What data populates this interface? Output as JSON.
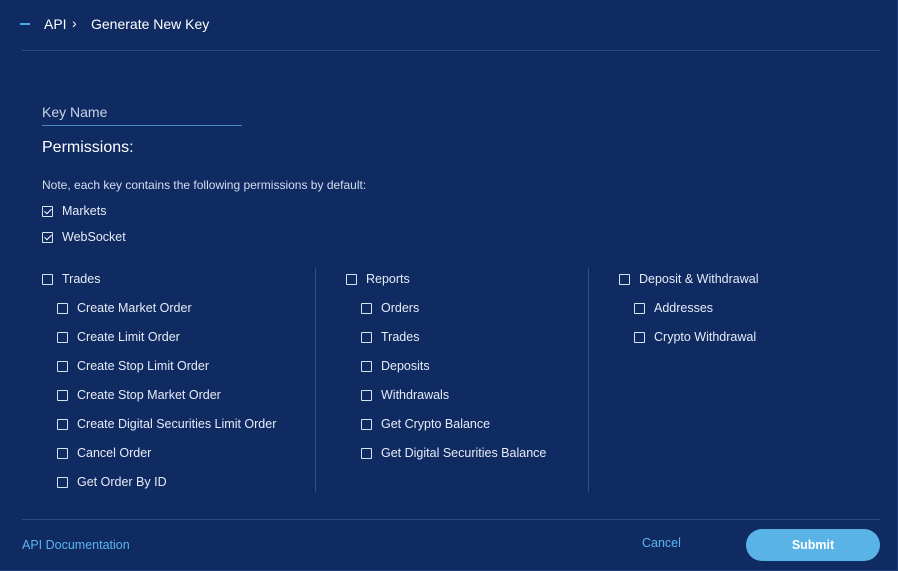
{
  "header": {
    "breadcrumb_root": "API",
    "breadcrumb_separator": "›",
    "title": "Generate New Key"
  },
  "form": {
    "key_name_placeholder": "Key Name",
    "key_name_value": "",
    "permissions_title": "Permissions:",
    "default_note": "Note, each key contains the following permissions by default:",
    "defaults": [
      {
        "label": "Markets",
        "checked": true
      },
      {
        "label": "WebSocket",
        "checked": true
      }
    ],
    "groups": [
      {
        "label": "Trades",
        "checked": false,
        "items": [
          {
            "label": "Create Market Order",
            "checked": false
          },
          {
            "label": "Create Limit Order",
            "checked": false
          },
          {
            "label": "Create Stop Limit Order",
            "checked": false
          },
          {
            "label": "Create Stop Market Order",
            "checked": false
          },
          {
            "label": "Create Digital Securities Limit Order",
            "checked": false
          },
          {
            "label": "Cancel Order",
            "checked": false
          },
          {
            "label": "Get Order By ID",
            "checked": false
          }
        ]
      },
      {
        "label": "Reports",
        "checked": false,
        "items": [
          {
            "label": "Orders",
            "checked": false
          },
          {
            "label": "Trades",
            "checked": false
          },
          {
            "label": "Deposits",
            "checked": false
          },
          {
            "label": "Withdrawals",
            "checked": false
          },
          {
            "label": "Get Crypto Balance",
            "checked": false
          },
          {
            "label": "Get Digital Securities Balance",
            "checked": false
          }
        ]
      },
      {
        "label": "Deposit & Withdrawal",
        "checked": false,
        "items": [
          {
            "label": "Addresses",
            "checked": false
          },
          {
            "label": "Crypto Withdrawal",
            "checked": false
          }
        ]
      }
    ]
  },
  "footer": {
    "doc_link": "API Documentation",
    "cancel_label": "Cancel",
    "submit_label": "Submit"
  },
  "colors": {
    "background": "#102a62",
    "accent": "#5ab3e6",
    "link": "#5ab6f0"
  },
  "icons": {
    "collapse": "minus-icon",
    "separator": "chevron-right-icon",
    "checkbox": "checkbox-icon"
  }
}
